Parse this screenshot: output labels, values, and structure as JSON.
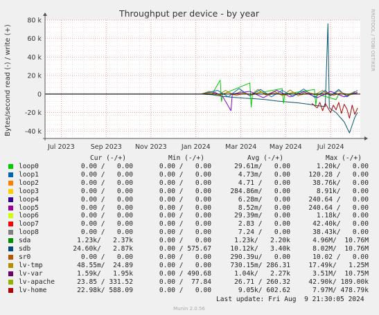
{
  "chart_data": {
    "type": "line",
    "title": "Throughput per device - by year",
    "ylabel": "Bytes/second read (-) / write (+)",
    "side_label": "RRDTOOL / TOBI OETIKER",
    "footer": "Munin 2.0.56",
    "ylim": [
      -48000,
      80000
    ],
    "y_ticks": [
      {
        "v": 80000,
        "label": "80 k"
      },
      {
        "v": 60000,
        "label": "60 k"
      },
      {
        "v": 40000,
        "label": "40 k"
      },
      {
        "v": 20000,
        "label": "20 k"
      },
      {
        "v": 0,
        "label": "0"
      },
      {
        "v": -20000,
        "label": "-20 k"
      },
      {
        "v": -40000,
        "label": "-40 k"
      }
    ],
    "x_ticks": [
      {
        "t": 2023.5,
        "label": "Jul 2023"
      },
      {
        "t": 2023.667,
        "label": "Sep 2023"
      },
      {
        "t": 2023.833,
        "label": "Nov 2023"
      },
      {
        "t": 2024.0,
        "label": "Jan 2024"
      },
      {
        "t": 2024.167,
        "label": "Mar 2024"
      },
      {
        "t": 2024.333,
        "label": "May 2024"
      },
      {
        "t": 2024.5,
        "label": "Jul 2024"
      }
    ],
    "xlim": [
      2023.44,
      2024.61
    ],
    "grid": true,
    "series": [
      {
        "name": "sdb",
        "color": "#00546e",
        "points": [
          [
            2023.44,
            0
          ],
          [
            2024.02,
            0
          ],
          [
            2024.06,
            -800
          ],
          [
            2024.1,
            -2500
          ],
          [
            2024.14,
            -3500
          ],
          [
            2024.18,
            -4500
          ],
          [
            2024.22,
            -5000
          ],
          [
            2024.26,
            -6000
          ],
          [
            2024.3,
            -7500
          ],
          [
            2024.34,
            -8500
          ],
          [
            2024.38,
            -9500
          ],
          [
            2024.42,
            -11000
          ],
          [
            2024.45,
            -12500
          ],
          [
            2024.48,
            -13500
          ],
          [
            2024.49,
            76000
          ],
          [
            2024.495,
            -15000
          ],
          [
            2024.52,
            -20000
          ],
          [
            2024.55,
            -30000
          ],
          [
            2024.57,
            -42000
          ],
          [
            2024.59,
            -25000
          ],
          [
            2024.6,
            -20000
          ]
        ]
      },
      {
        "name": "lv-home",
        "color": "#aa0000",
        "points": [
          [
            2024.43,
            -10000
          ],
          [
            2024.45,
            -15000
          ],
          [
            2024.46,
            -9000
          ],
          [
            2024.47,
            -18000
          ],
          [
            2024.48,
            -10000
          ],
          [
            2024.5,
            -20000
          ],
          [
            2024.51,
            -12000
          ],
          [
            2024.52,
            -17000
          ],
          [
            2024.53,
            -9000
          ],
          [
            2024.54,
            -21000
          ],
          [
            2024.55,
            -11000
          ],
          [
            2024.56,
            -16000
          ],
          [
            2024.57,
            -26000
          ],
          [
            2024.58,
            -12000
          ],
          [
            2024.59,
            -22000
          ],
          [
            2024.6,
            -15000
          ]
        ]
      },
      {
        "name": "lv-apache",
        "color": "#888800",
        "points": [
          [
            2024.02,
            0
          ],
          [
            2024.05,
            3000
          ],
          [
            2024.08,
            -1500
          ],
          [
            2024.11,
            4000
          ],
          [
            2024.14,
            -1000
          ],
          [
            2024.17,
            3500
          ],
          [
            2024.2,
            -2000
          ],
          [
            2024.23,
            5000
          ],
          [
            2024.26,
            -1000
          ],
          [
            2024.29,
            3000
          ],
          [
            2024.32,
            -1500
          ],
          [
            2024.35,
            4500
          ],
          [
            2024.38,
            -2000
          ],
          [
            2024.41,
            3000
          ],
          [
            2024.44,
            -1000
          ],
          [
            2024.47,
            4000
          ],
          [
            2024.5,
            -2000
          ],
          [
            2024.53,
            3500
          ],
          [
            2024.56,
            -1500
          ],
          [
            2024.59,
            3000
          ]
        ]
      },
      {
        "name": "loop0",
        "color": "#00cc00",
        "points": [
          [
            2024.06,
            0
          ],
          [
            2024.09,
            15000
          ],
          [
            2024.095,
            -8000
          ],
          [
            2024.1,
            0
          ],
          [
            2024.2,
            12000
          ],
          [
            2024.205,
            -14000
          ],
          [
            2024.21,
            0
          ],
          [
            2024.32,
            6000
          ],
          [
            2024.325,
            -10000
          ],
          [
            2024.33,
            0
          ],
          [
            2024.44,
            5000
          ],
          [
            2024.445,
            -12000
          ],
          [
            2024.45,
            0
          ],
          [
            2024.52,
            -6000
          ],
          [
            2024.53,
            0
          ]
        ]
      },
      {
        "name": "lv-var",
        "color": "#8a00cc",
        "points": [
          [
            2024.02,
            0
          ],
          [
            2024.07,
            2000
          ],
          [
            2024.1,
            -3000
          ],
          [
            2024.13,
            -18000
          ],
          [
            2024.135,
            0
          ],
          [
            2024.2,
            3000
          ],
          [
            2024.25,
            -4000
          ],
          [
            2024.3,
            4000
          ],
          [
            2024.35,
            -3000
          ],
          [
            2024.4,
            2500
          ],
          [
            2024.45,
            -4000
          ],
          [
            2024.5,
            3000
          ],
          [
            2024.55,
            -3000
          ],
          [
            2024.6,
            2000
          ]
        ]
      },
      {
        "name": "sda",
        "color": "#0066b3",
        "points": [
          [
            2024.02,
            0
          ],
          [
            2024.08,
            4000
          ],
          [
            2024.12,
            -3000
          ],
          [
            2024.16,
            6000
          ],
          [
            2024.2,
            -2000
          ],
          [
            2024.24,
            5000
          ],
          [
            2024.28,
            -3000
          ],
          [
            2024.32,
            4000
          ],
          [
            2024.36,
            -2500
          ],
          [
            2024.4,
            5500
          ],
          [
            2024.44,
            -3500
          ],
          [
            2024.48,
            4000
          ],
          [
            2024.5,
            -2000
          ],
          [
            2024.53,
            5000
          ],
          [
            2024.56,
            -3000
          ],
          [
            2024.6,
            4000
          ]
        ]
      },
      {
        "name": "lv-tmp",
        "color": "#cc7700",
        "points": [
          [
            2024.02,
            0
          ],
          [
            2024.06,
            1500
          ],
          [
            2024.09,
            -1000
          ],
          [
            2024.12,
            2000
          ],
          [
            2024.15,
            -1500
          ],
          [
            2024.18,
            1000
          ],
          [
            2024.21,
            -1000
          ],
          [
            2024.24,
            2500
          ],
          [
            2024.27,
            -1000
          ],
          [
            2024.3,
            1500
          ],
          [
            2024.33,
            -1500
          ],
          [
            2024.36,
            2000
          ],
          [
            2024.39,
            -1000
          ],
          [
            2024.42,
            1500
          ],
          [
            2024.45,
            -1000
          ],
          [
            2024.48,
            2000
          ],
          [
            2024.51,
            -1500
          ],
          [
            2024.54,
            1500
          ],
          [
            2024.57,
            -1000
          ],
          [
            2024.6,
            1000
          ]
        ]
      }
    ],
    "legend": {
      "headers": {
        "cur": "Cur (-/+)",
        "min": "Min (-/+)",
        "avg": "Avg (-/+)",
        "max": "Max (-/+)"
      },
      "rows": [
        {
          "name": "loop0",
          "color": "#00cc00",
          "cur": "0.00 /   0.00",
          "min": "0.00 /   0.00",
          "avg": "29.61m/   0.00",
          "max": "1.20k/   0.00"
        },
        {
          "name": "loop1",
          "color": "#0066b3",
          "cur": "0.00 /   0.00",
          "min": "0.00 /   0.00",
          "avg": "4.73m/   0.00",
          "max": "120.28 /   0.00"
        },
        {
          "name": "loop2",
          "color": "#ff8000",
          "cur": "0.00 /   0.00",
          "min": "0.00 /   0.00",
          "avg": "4.71 /   0.00",
          "max": "38.76k/   0.00"
        },
        {
          "name": "loop3",
          "color": "#ffcc00",
          "cur": "0.00 /   0.00",
          "min": "0.00 /   0.00",
          "avg": "284.86m/   0.00",
          "max": "8.91k/   0.00"
        },
        {
          "name": "loop4",
          "color": "#330099",
          "cur": "0.00 /   0.00",
          "min": "0.00 /   0.00",
          "avg": "6.28m/   0.00",
          "max": "240.64 /   0.00"
        },
        {
          "name": "loop5",
          "color": "#990099",
          "cur": "0.00 /   0.00",
          "min": "0.00 /   0.00",
          "avg": "8.52m/   0.00",
          "max": "240.64 /   0.00"
        },
        {
          "name": "loop6",
          "color": "#ccff00",
          "cur": "0.00 /   0.00",
          "min": "0.00 /   0.00",
          "avg": "29.39m/   0.00",
          "max": "1.18k/   0.00"
        },
        {
          "name": "loop7",
          "color": "#ff0000",
          "cur": "0.00 /   0.00",
          "min": "0.00 /   0.00",
          "avg": "2.83 /   0.00",
          "max": "42.40k/   0.00"
        },
        {
          "name": "loop8",
          "color": "#808080",
          "cur": "0.00 /   0.00",
          "min": "0.00 /   0.00",
          "avg": "7.24 /   0.00",
          "max": "38.43k/   0.00"
        },
        {
          "name": "sda",
          "color": "#008f00",
          "cur": "1.23k/   2.37k",
          "min": "0.00 /   0.00",
          "avg": "1.23k/   2.20k",
          "max": "4.96M/  10.76M"
        },
        {
          "name": "sdb",
          "color": "#00487d",
          "cur": "24.60k/   2.87k",
          "min": "0.00 / 575.67",
          "avg": "10.12k/   3.40k",
          "max": "8.02M/  10.76M"
        },
        {
          "name": "sr0",
          "color": "#b35a00",
          "cur": "0.00 /   0.00",
          "min": "0.00 /   0.00",
          "avg": "290.39u/   0.00",
          "max": "10.02 /   0.00"
        },
        {
          "name": "lv-tmp",
          "color": "#b38f00",
          "cur": "48.55m/  24.89",
          "min": "0.00 /   0.00",
          "avg": "730.15m/ 286.31",
          "max": "17.49k/   1.25M"
        },
        {
          "name": "lv-var",
          "color": "#6b006b",
          "cur": "1.59k/   1.95k",
          "min": "0.00 / 490.68",
          "avg": "1.04k/   2.27k",
          "max": "3.51M/  10.75M"
        },
        {
          "name": "lv-apache",
          "color": "#8fb300",
          "cur": "23.85 / 331.52",
          "min": "0.00 /  77.84",
          "avg": "26.71 / 260.32",
          "max": "42.90k/ 189.00k"
        },
        {
          "name": "lv-home",
          "color": "#b30000",
          "cur": "22.98k/ 588.09",
          "min": "0.00 /   0.00",
          "avg": "9.05k/ 602.62",
          "max": "7.97M/ 478.79k"
        }
      ]
    },
    "last_update": "Last update: Fri Aug  9 21:30:05 2024"
  }
}
